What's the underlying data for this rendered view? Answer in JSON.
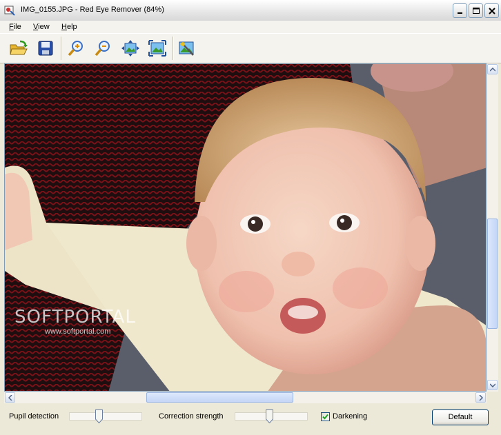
{
  "window": {
    "title": "IMG_0155.JPG - Red Eye Remover (84%)",
    "app_icon": "red-eye-remover-icon",
    "controls": [
      "minimize-icon",
      "maximize-icon",
      "close-icon"
    ]
  },
  "menubar": {
    "items": [
      {
        "label": "File",
        "underline": "F",
        "rest": "ile"
      },
      {
        "label": "View",
        "underline": "V",
        "rest": "iew"
      },
      {
        "label": "Help",
        "underline": "H",
        "rest": "elp"
      }
    ]
  },
  "toolbar": {
    "buttons": [
      "open-folder-icon",
      "save-icon",
      "zoom-in-icon",
      "zoom-out-icon",
      "fit-to-window-icon",
      "actual-size-icon",
      "remove-red-eye-icon"
    ]
  },
  "canvas": {
    "image": "baby-photo",
    "watermark": {
      "brand": "SOFTPORTAL",
      "url": "www.softportal.com"
    }
  },
  "scrollbars": {
    "vertical_position": 0.55,
    "horizontal_position": 0.45
  },
  "controls": {
    "pupil_detection": {
      "label": "Pupil detection",
      "value": 0.4
    },
    "correction_strength": {
      "label": "Correction strength",
      "value": 0.47
    },
    "darkening": {
      "label": "Darkening",
      "checked": true
    },
    "default_button": "Default"
  },
  "colors": {
    "titlebar": "#e6e6e6",
    "window_bg": "#ece9d8",
    "accent_blue": "#316ac5"
  }
}
